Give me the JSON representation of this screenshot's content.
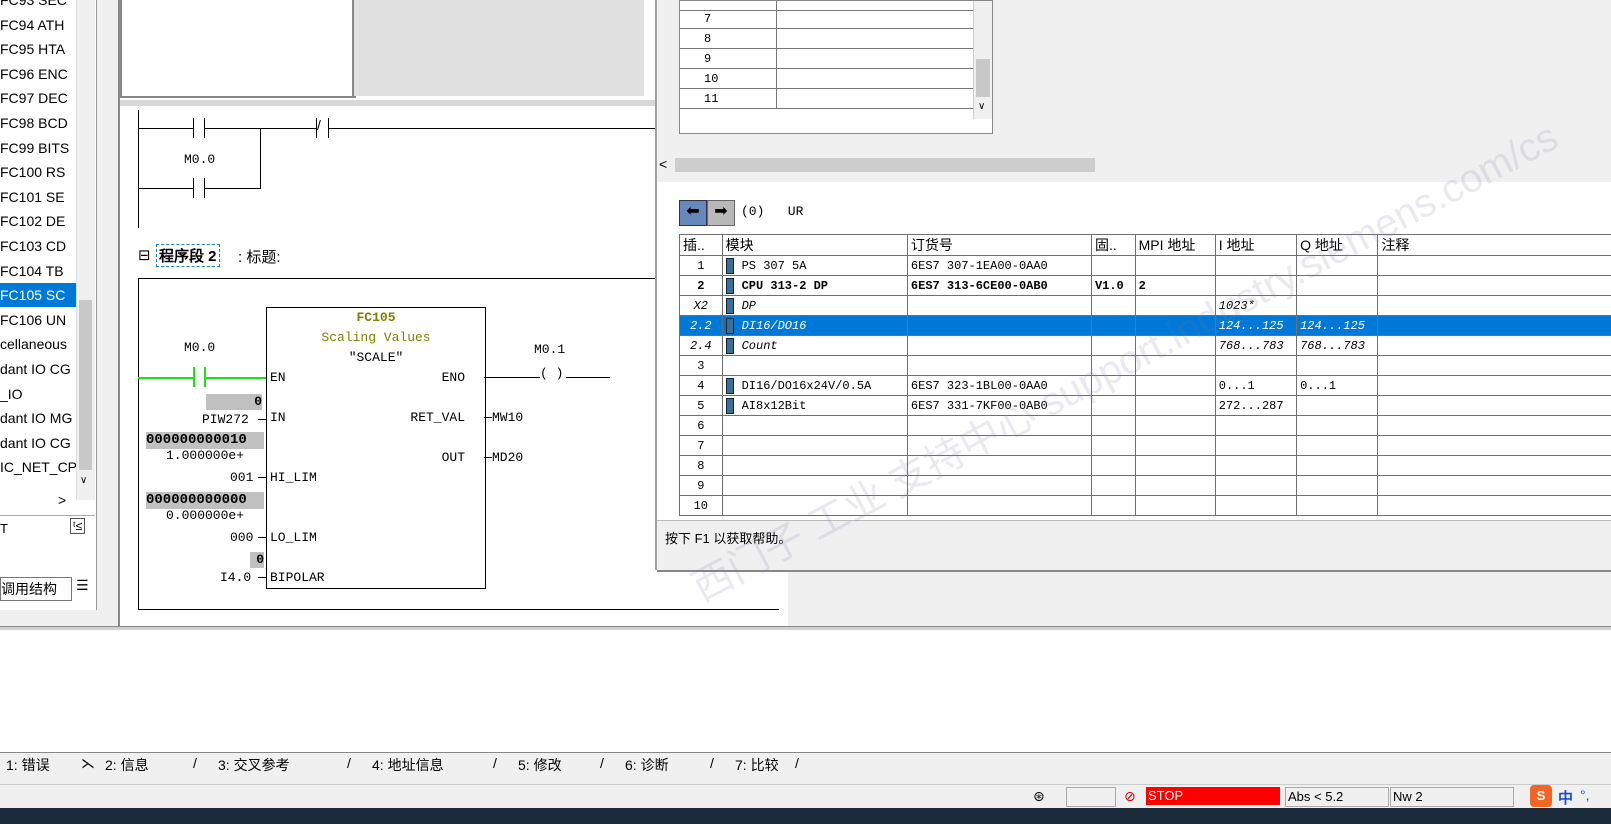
{
  "block_list": {
    "items": [
      {
        "id": "FC93",
        "name": "SEC"
      },
      {
        "id": "FC94",
        "name": "ATH"
      },
      {
        "id": "FC95",
        "name": "HTA"
      },
      {
        "id": "FC96",
        "name": "ENC"
      },
      {
        "id": "FC97",
        "name": "DEC"
      },
      {
        "id": "FC98",
        "name": "BCD"
      },
      {
        "id": "FC99",
        "name": "BITS"
      },
      {
        "id": "FC100",
        "name": "RS"
      },
      {
        "id": "FC101",
        "name": "SE"
      },
      {
        "id": "FC102",
        "name": "DE"
      },
      {
        "id": "FC103",
        "name": "CD"
      },
      {
        "id": "FC104",
        "name": "TB"
      },
      {
        "id": "FC105",
        "name": "SC"
      },
      {
        "id": "FC106",
        "name": "UN"
      }
    ],
    "others": [
      "cellaneous",
      "dant IO CG",
      "_IO",
      "dant IO MG",
      "dant IO CG",
      "IC_NET_CP"
    ],
    "bottom_text": "T",
    "call_structure_tab": "调用结构"
  },
  "ladder": {
    "contact_label_m00": "M0.0",
    "network_title": "程序段 2",
    "network_suffix": ": 标题:",
    "fc_name": "FC105",
    "fc_desc": "Scaling Values",
    "fc_symbol": "\"SCALE\"",
    "en": "EN",
    "eno": "ENO",
    "in_pin": "IN",
    "in_operand": "PIW272",
    "in_value": "0",
    "retval_pin": "RET_VAL",
    "retval_operand": "MW10",
    "out_pin": "OUT",
    "out_operand": "MD20",
    "hilim_pin": "HI_LIM",
    "hilim_value": "000000000010",
    "hilim_operand1": "1.000000e+",
    "hilim_operand2": "001",
    "lolim_pin": "LO_LIM",
    "lolim_value": "000000000000",
    "lolim_operand1": "0.000000e+",
    "lolim_operand2": "000",
    "bipolar_pin": "BIPOLAR",
    "bipolar_operand": "I4.0",
    "bipolar_value": "0",
    "coil_label": "M0.1",
    "coil_symbol": "( )"
  },
  "hw_config": {
    "top_rows": [
      "7",
      "8",
      "9",
      "10",
      "11"
    ],
    "rack_label": "(0)   UR",
    "headers": [
      "插..",
      "模块",
      "订货号",
      "固..",
      "MPI 地址",
      "I 地址",
      "Q 地址",
      "注释"
    ],
    "rows": [
      {
        "slot": "1",
        "module": "PS 307 5A",
        "order": "6ES7 307-1EA00-0AA0",
        "fw": "",
        "mpi": "",
        "i": "",
        "q": "",
        "bold": false,
        "italic": false
      },
      {
        "slot": "2",
        "module": "CPU 313-2 DP",
        "order": "6ES7 313-6CE00-0AB0",
        "fw": "V1.0",
        "mpi": "2",
        "i": "",
        "q": "",
        "bold": true,
        "italic": false
      },
      {
        "slot": "X2",
        "module": "DP",
        "order": "",
        "fw": "",
        "mpi": "",
        "i": "1023*",
        "q": "",
        "bold": false,
        "italic": true
      },
      {
        "slot": "2.2",
        "module": "DI16/DO16",
        "order": "",
        "fw": "",
        "mpi": "",
        "i": "124...125",
        "q": "124...125",
        "bold": false,
        "italic": true,
        "selected": true
      },
      {
        "slot": "2.4",
        "module": "Count",
        "order": "",
        "fw": "",
        "mpi": "",
        "i": "768...783",
        "q": "768...783",
        "bold": false,
        "italic": true
      },
      {
        "slot": "3",
        "module": "",
        "order": "",
        "fw": "",
        "mpi": "",
        "i": "",
        "q": "",
        "bold": false,
        "italic": false
      },
      {
        "slot": "4",
        "module": "DI16/DO16x24V/0.5A",
        "order": "6ES7 323-1BL00-0AA0",
        "fw": "",
        "mpi": "",
        "i": "0...1",
        "q": "0...1",
        "bold": false,
        "italic": false
      },
      {
        "slot": "5",
        "module": "AI8x12Bit",
        "order": "6ES7 331-7KF00-0AB0",
        "fw": "",
        "mpi": "",
        "i": "272...287",
        "q": "",
        "bold": false,
        "italic": false
      },
      {
        "slot": "6",
        "module": "",
        "order": "",
        "fw": "",
        "mpi": "",
        "i": "",
        "q": "",
        "bold": false,
        "italic": false
      },
      {
        "slot": "7",
        "module": "",
        "order": "",
        "fw": "",
        "mpi": "",
        "i": "",
        "q": "",
        "bold": false,
        "italic": false
      },
      {
        "slot": "8",
        "module": "",
        "order": "",
        "fw": "",
        "mpi": "",
        "i": "",
        "q": "",
        "bold": false,
        "italic": false
      },
      {
        "slot": "9",
        "module": "",
        "order": "",
        "fw": "",
        "mpi": "",
        "i": "",
        "q": "",
        "bold": false,
        "italic": false
      },
      {
        "slot": "10",
        "module": "",
        "order": "",
        "fw": "",
        "mpi": "",
        "i": "",
        "q": "",
        "bold": false,
        "italic": false
      }
    ],
    "help_text": "按下 F1 以获取帮助。",
    "watermark": "西门子 工业 支持中心 support.industry.siemens.com/cs"
  },
  "bottom_tabs": [
    "1: 错误",
    "2: 信息",
    "3: 交叉参考",
    "4: 地址信息",
    "5: 修改",
    "6: 诊断",
    "7: 比较"
  ],
  "status": {
    "mode": "STOP",
    "abs": "Abs < 5.2",
    "nw": "Nw 2",
    "ime": "中"
  },
  "colors": {
    "selection": "#0078d7",
    "stop": "#ff0000",
    "power_flow": "#1ee01e",
    "fc_title": "#808000"
  }
}
